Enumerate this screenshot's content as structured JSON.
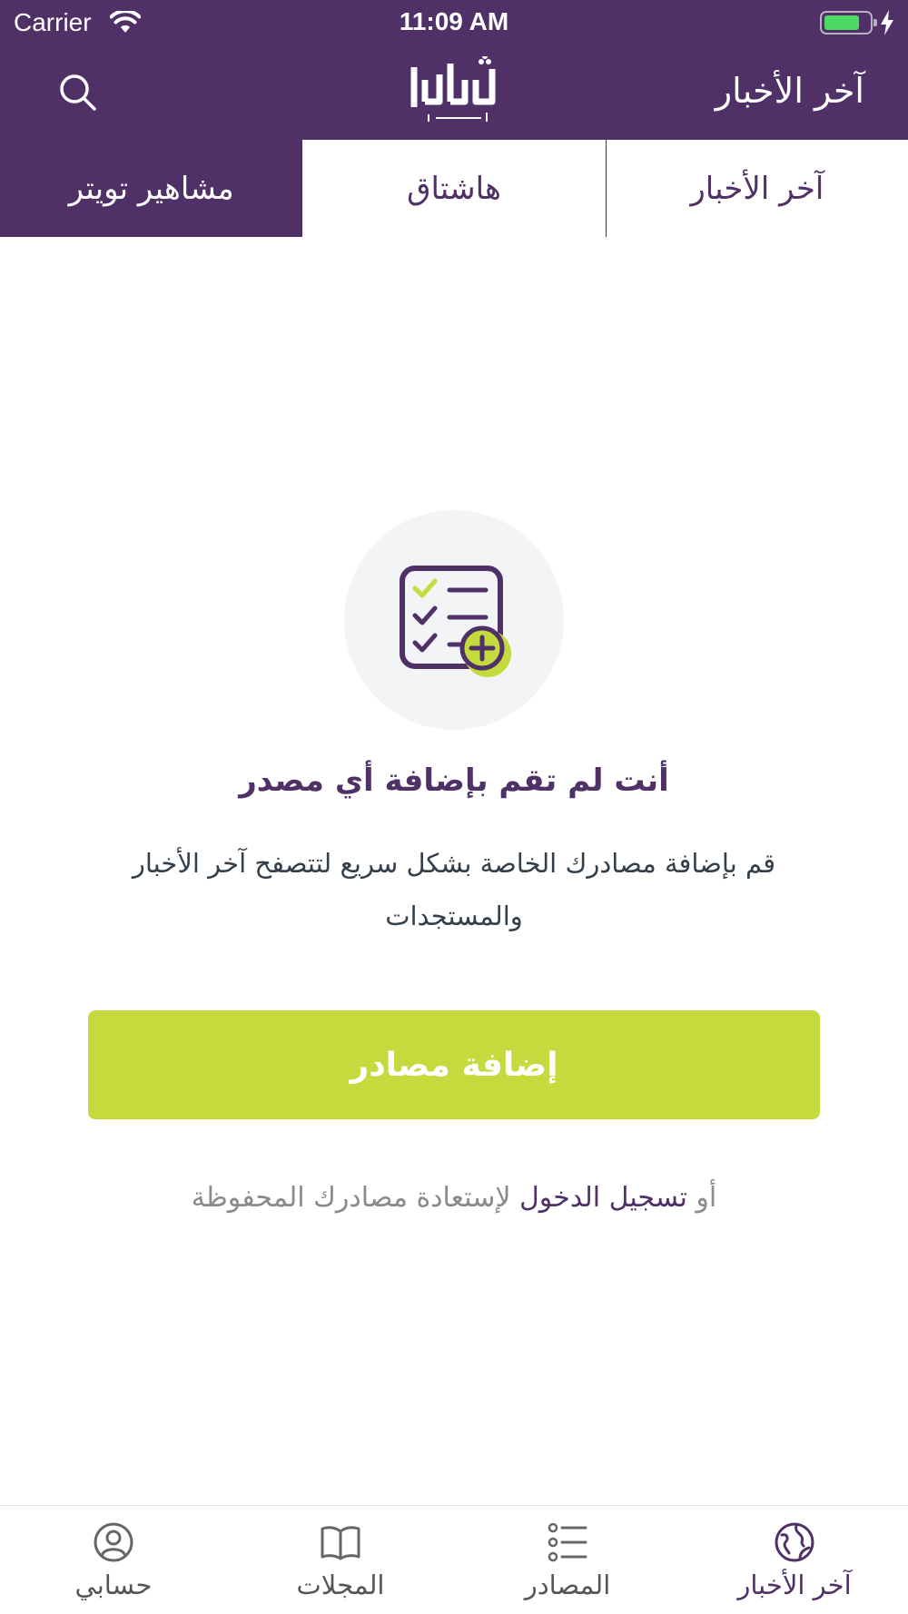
{
  "status_bar": {
    "carrier": "Carrier",
    "time": "11:09 AM"
  },
  "nav": {
    "title": "آخر الأخبار",
    "logo_icon": "shamel-news-logo",
    "search_icon": "search-icon"
  },
  "tabs": [
    {
      "label": "آخر الأخبار",
      "active": false
    },
    {
      "label": "هاشتاق",
      "active": false
    },
    {
      "label": "مشاهير تويتر",
      "active": true
    }
  ],
  "empty_state": {
    "icon": "checklist-add-icon",
    "title": "أنت لم تقم بإضافة أي مصدر",
    "description": "قم بإضافة مصادرك الخاصة بشكل سريع لتتصفح آخر الأخبار والمستجدات",
    "add_button": "إضافة مصادر",
    "login_prefix": "أو",
    "login_link": "تسجيل الدخول",
    "login_suffix": "لإستعادة مصادرك المحفوظة"
  },
  "tab_bar": [
    {
      "label": "آخر الأخبار",
      "icon": "globe-icon",
      "active": true
    },
    {
      "label": "المصادر",
      "icon": "list-icon",
      "active": false
    },
    {
      "label": "المجلات",
      "icon": "book-icon",
      "active": false
    },
    {
      "label": "حسابي",
      "icon": "account-icon",
      "active": false
    }
  ],
  "colors": {
    "brand_purple": "#4f3167",
    "accent_green": "#c5da3d",
    "illustration_bg": "#f3f4f6"
  }
}
